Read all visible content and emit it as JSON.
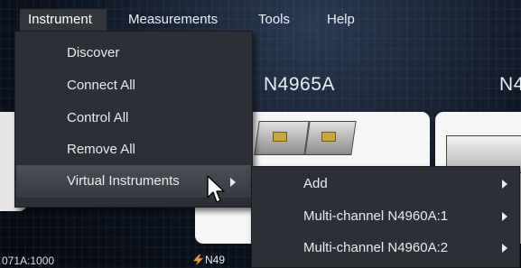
{
  "menubar": {
    "items": [
      {
        "label": "Instrument"
      },
      {
        "label": "Measurements"
      },
      {
        "label": "Tools"
      },
      {
        "label": "Help"
      }
    ]
  },
  "instrument_menu": {
    "items": [
      {
        "label": "Discover"
      },
      {
        "label": "Connect All"
      },
      {
        "label": "Control All"
      },
      {
        "label": "Remove All"
      },
      {
        "label": "Virtual Instruments"
      }
    ]
  },
  "virtual_instruments_submenu": {
    "items": [
      {
        "label": "Add"
      },
      {
        "label": "Multi-channel N4960A:1"
      },
      {
        "label": "Multi-channel N4960A:2"
      }
    ]
  },
  "background": {
    "instrument_titles": [
      "N4965A",
      "N4"
    ],
    "bottom_left_text": "071A:1000",
    "bottom_badge_text": "N49"
  },
  "colors": {
    "menu_bg": "#2c3036",
    "menu_text": "#e8ebef",
    "highlight": "#4a4f56"
  }
}
